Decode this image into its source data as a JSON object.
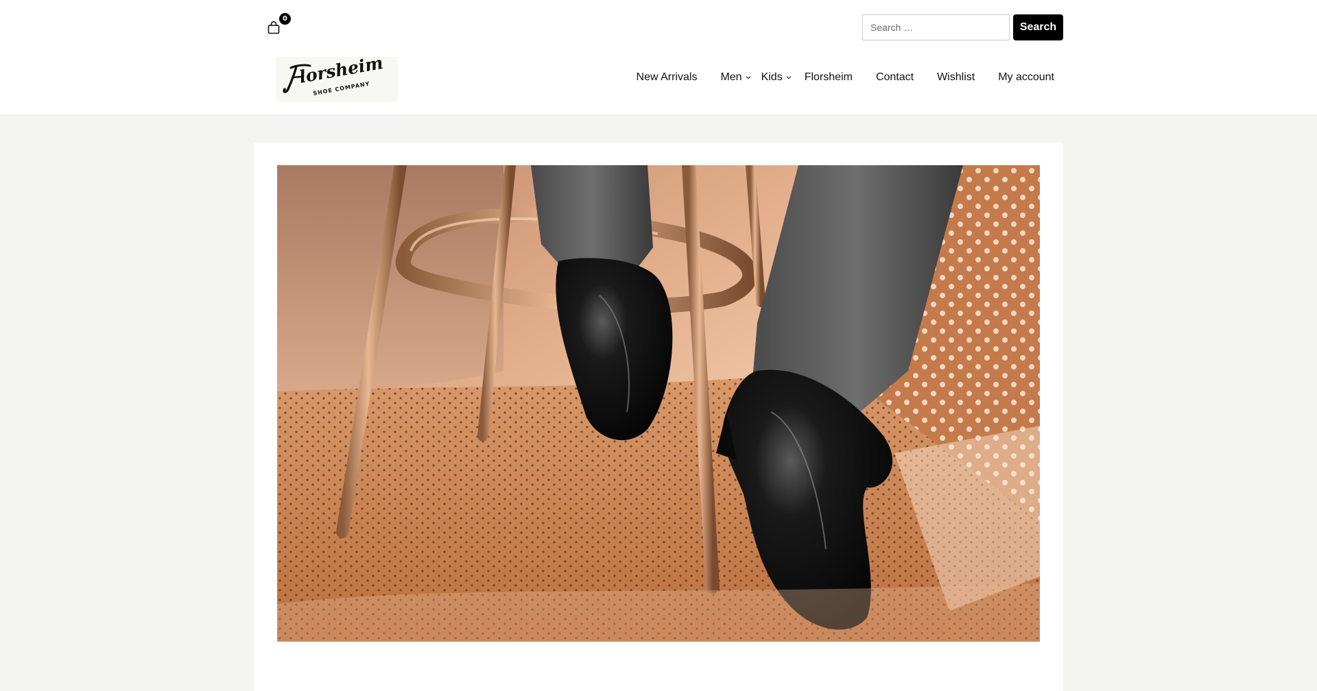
{
  "header": {
    "cart": {
      "icon": "shopping-bag-icon",
      "count": "0"
    },
    "search": {
      "placeholder": "Search …",
      "value": "",
      "button_label": "Search"
    },
    "logo": {
      "text": "Florsheim",
      "subtext": "SHOE COMPANY"
    },
    "nav": [
      {
        "label": "New Arrivals",
        "has_submenu": false
      },
      {
        "label": "Men",
        "has_submenu": true
      },
      {
        "label": "Kids",
        "has_submenu": true
      },
      {
        "label": "Florsheim",
        "has_submenu": false
      },
      {
        "label": "Contact",
        "has_submenu": false
      },
      {
        "label": "Wishlist",
        "has_submenu": false
      },
      {
        "label": "My account",
        "has_submenu": false
      }
    ]
  },
  "hero": {
    "image": "hero-image"
  },
  "colors": {
    "page_bg": "#f4f5f2",
    "header_bg": "#ffffff",
    "button_bg": "#000000",
    "text": "#111111"
  }
}
